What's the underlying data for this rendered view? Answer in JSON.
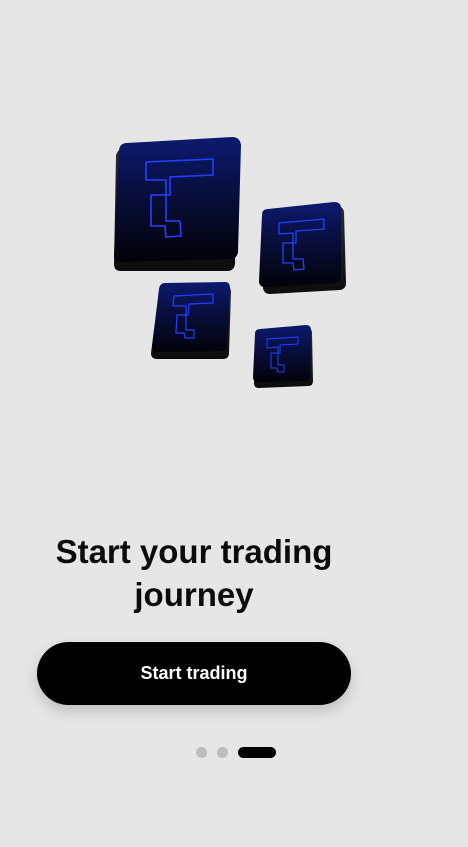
{
  "onboarding": {
    "headline": "Start your trading journey",
    "cta_label": "Start trading",
    "page_indicator": {
      "total": 3,
      "current": 3
    }
  },
  "colors": {
    "background": "#e6e6e6",
    "button": "#000000",
    "button_text": "#ffffff",
    "tile_top": "#0c1a6e",
    "tile_glow": "#1f3cff",
    "dot_inactive": "#bdbdbd",
    "dot_active": "#000000"
  },
  "icons": [
    "logo-tile-icon"
  ]
}
